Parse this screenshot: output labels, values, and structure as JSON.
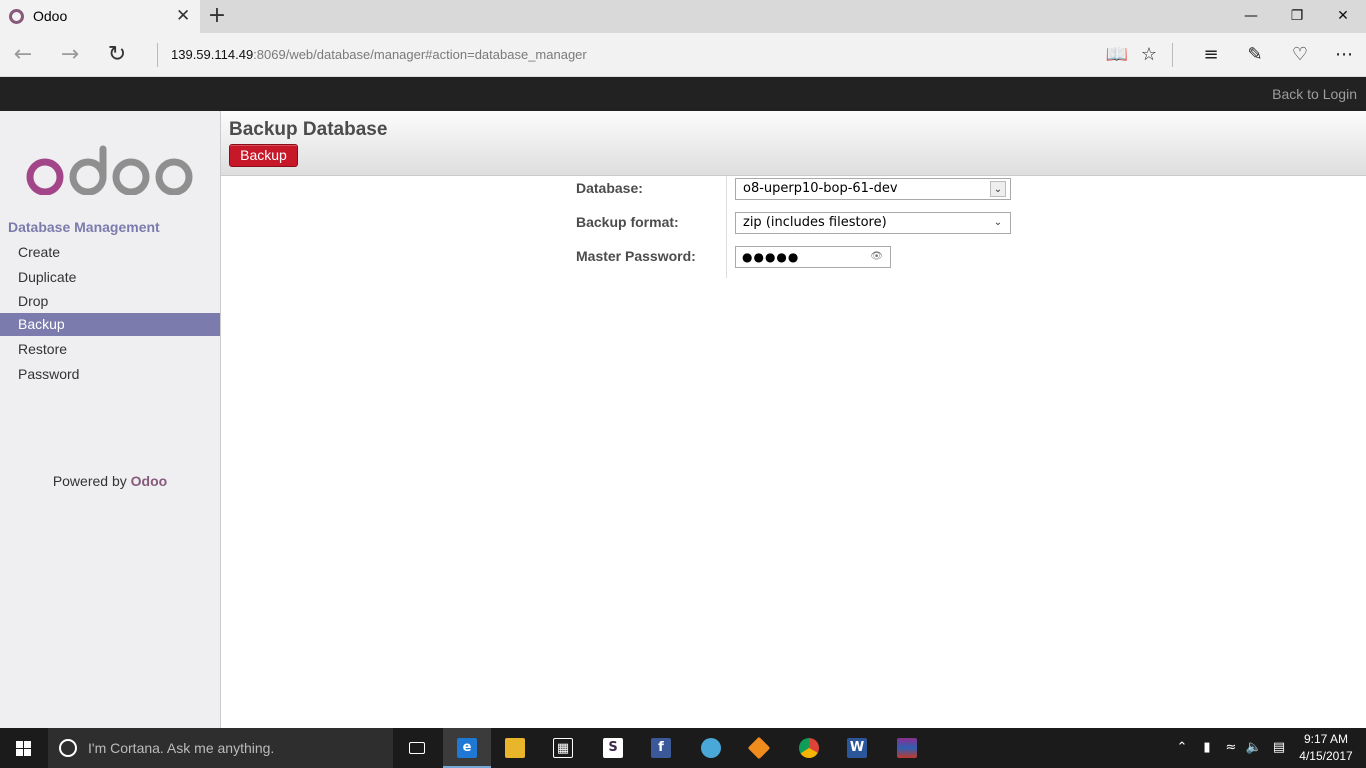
{
  "browser": {
    "tab_title": "Odoo",
    "tab_close": "✕",
    "new_tab": "+",
    "url_host": "139.59.114.49",
    "url_rest": ":8069/web/database/manager#action=database_manager",
    "icons": [
      "back-icon",
      "forward-icon",
      "refresh-icon",
      "reading-view-icon",
      "favorite-star-icon",
      "hub-icon",
      "web-note-icon",
      "share-icon",
      "more-icon"
    ]
  },
  "topbar": {
    "back_to_login": "Back to Login"
  },
  "sidebar": {
    "heading": "Database Management",
    "items": [
      {
        "label": "Create",
        "active": false
      },
      {
        "label": "Duplicate",
        "active": false
      },
      {
        "label": "Drop",
        "active": false
      },
      {
        "label": "Backup",
        "active": true
      },
      {
        "label": "Restore",
        "active": false
      },
      {
        "label": "Password",
        "active": false
      }
    ],
    "powered_prefix": "Powered by ",
    "powered_brand": "Odoo"
  },
  "header": {
    "title": "Backup Database",
    "button": "Backup"
  },
  "form": {
    "database_label": "Database:",
    "database_value": "o8-uperp10-bop-61-dev",
    "format_label": "Backup format:",
    "format_value": "zip (includes filestore)",
    "password_label": "Master Password:",
    "password_value": "●●●●●"
  },
  "taskbar": {
    "cortana_text": "I'm Cortana. Ask me anything.",
    "time": "9:17 AM",
    "date": "4/15/2017"
  },
  "colors": {
    "odoo_purple": "#875a7b",
    "sidebar_accent": "#7c7bad",
    "backup_red": "#c7182a"
  }
}
